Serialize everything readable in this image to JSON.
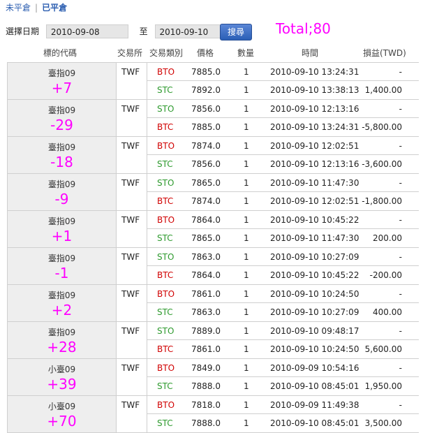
{
  "tabs": {
    "open": "未平倉",
    "separator": "|",
    "closed": "已平倉"
  },
  "filter": {
    "label": "選擇日期",
    "from": "2010-09-08",
    "to_label": "至",
    "to": "2010-09-10",
    "search": "搜尋"
  },
  "total": "Total;80",
  "headers": {
    "symbol": "標的代碼",
    "exchange": "交易所",
    "type": "交易類別",
    "price": "價格",
    "qty": "數量",
    "time": "時間",
    "pl": "損益(TWD)"
  },
  "colors": {
    "red": "#d00000",
    "green": "#2e9a2e",
    "magenta": "#ff00ff"
  },
  "groups": [
    {
      "symbol": "臺指09",
      "delta": "+7",
      "exchange": "TWF",
      "rows": [
        {
          "type": "BTO",
          "price": "7885.0",
          "qty": "1",
          "time": "2010-09-10 13:24:31",
          "pl": "-"
        },
        {
          "type": "STC",
          "price": "7892.0",
          "qty": "1",
          "time": "2010-09-10 13:38:13",
          "pl": "1,400.00"
        }
      ]
    },
    {
      "symbol": "臺指09",
      "delta": "-29",
      "exchange": "TWF",
      "rows": [
        {
          "type": "STO",
          "price": "7856.0",
          "qty": "1",
          "time": "2010-09-10 12:13:16",
          "pl": "-"
        },
        {
          "type": "BTC",
          "price": "7885.0",
          "qty": "1",
          "time": "2010-09-10 13:24:31",
          "pl": "-5,800.00"
        }
      ]
    },
    {
      "symbol": "臺指09",
      "delta": "-18",
      "exchange": "TWF",
      "rows": [
        {
          "type": "BTO",
          "price": "7874.0",
          "qty": "1",
          "time": "2010-09-10 12:02:51",
          "pl": "-"
        },
        {
          "type": "STC",
          "price": "7856.0",
          "qty": "1",
          "time": "2010-09-10 12:13:16",
          "pl": "-3,600.00"
        }
      ]
    },
    {
      "symbol": "臺指09",
      "delta": "-9",
      "exchange": "TWF",
      "rows": [
        {
          "type": "STO",
          "price": "7865.0",
          "qty": "1",
          "time": "2010-09-10 11:47:30",
          "pl": "-"
        },
        {
          "type": "BTC",
          "price": "7874.0",
          "qty": "1",
          "time": "2010-09-10 12:02:51",
          "pl": "-1,800.00"
        }
      ]
    },
    {
      "symbol": "臺指09",
      "delta": "+1",
      "exchange": "TWF",
      "rows": [
        {
          "type": "BTO",
          "price": "7864.0",
          "qty": "1",
          "time": "2010-09-10 10:45:22",
          "pl": "-"
        },
        {
          "type": "STC",
          "price": "7865.0",
          "qty": "1",
          "time": "2010-09-10 11:47:30",
          "pl": "200.00"
        }
      ]
    },
    {
      "symbol": "臺指09",
      "delta": "-1",
      "exchange": "TWF",
      "rows": [
        {
          "type": "STO",
          "price": "7863.0",
          "qty": "1",
          "time": "2010-09-10 10:27:09",
          "pl": "-"
        },
        {
          "type": "BTC",
          "price": "7864.0",
          "qty": "1",
          "time": "2010-09-10 10:45:22",
          "pl": "-200.00"
        }
      ]
    },
    {
      "symbol": "臺指09",
      "delta": "+2",
      "exchange": "TWF",
      "rows": [
        {
          "type": "BTO",
          "price": "7861.0",
          "qty": "1",
          "time": "2010-09-10 10:24:50",
          "pl": "-"
        },
        {
          "type": "STC",
          "price": "7863.0",
          "qty": "1",
          "time": "2010-09-10 10:27:09",
          "pl": "400.00"
        }
      ]
    },
    {
      "symbol": "臺指09",
      "delta": "+28",
      "exchange": "TWF",
      "rows": [
        {
          "type": "STO",
          "price": "7889.0",
          "qty": "1",
          "time": "2010-09-10 09:48:17",
          "pl": "-"
        },
        {
          "type": "BTC",
          "price": "7861.0",
          "qty": "1",
          "time": "2010-09-10 10:24:50",
          "pl": "5,600.00"
        }
      ]
    },
    {
      "symbol": "小臺09",
      "delta": "+39",
      "exchange": "TWF",
      "rows": [
        {
          "type": "BTO",
          "price": "7849.0",
          "qty": "1",
          "time": "2010-09-09 10:54:16",
          "pl": "-"
        },
        {
          "type": "STC",
          "price": "7888.0",
          "qty": "1",
          "time": "2010-09-10 08:45:01",
          "pl": "1,950.00"
        }
      ]
    },
    {
      "symbol": "小臺09",
      "delta": "+70",
      "exchange": "TWF",
      "rows": [
        {
          "type": "BTO",
          "price": "7818.0",
          "qty": "1",
          "time": "2010-09-09 11:49:38",
          "pl": "-"
        },
        {
          "type": "STC",
          "price": "7888.0",
          "qty": "1",
          "time": "2010-09-10 08:45:01",
          "pl": "3,500.00"
        }
      ]
    }
  ]
}
